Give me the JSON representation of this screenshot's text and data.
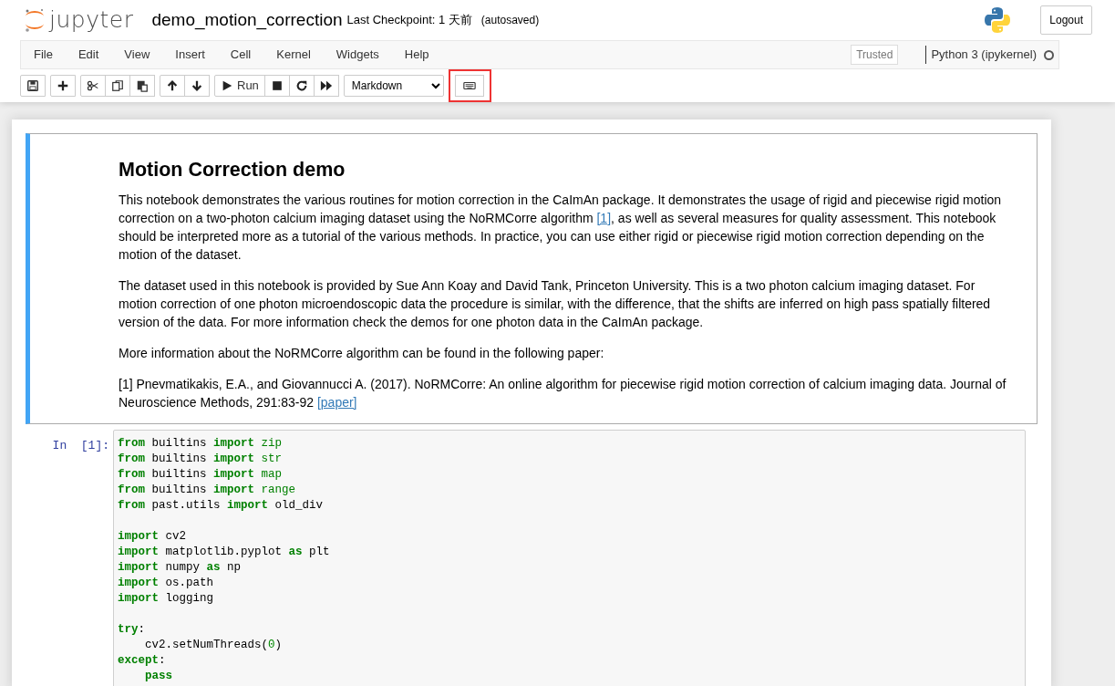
{
  "header": {
    "logo_text": "jupyter",
    "notebook_name": "demo_motion_correction",
    "checkpoint": "Last Checkpoint: 1 天前",
    "autosave": "(autosaved)",
    "logout": "Logout"
  },
  "menu": {
    "items": [
      "File",
      "Edit",
      "View",
      "Insert",
      "Cell",
      "Kernel",
      "Widgets",
      "Help"
    ],
    "trusted": "Trusted",
    "kernel": "Python 3 (ipykernel)",
    "kernel_busy": false
  },
  "toolbar": {
    "groups": [
      [
        {
          "kind": "save"
        }
      ],
      [
        {
          "kind": "plus"
        }
      ],
      [
        {
          "kind": "cut"
        },
        {
          "kind": "copy"
        },
        {
          "kind": "paste"
        }
      ],
      [
        {
          "kind": "up"
        },
        {
          "kind": "down"
        }
      ],
      [
        {
          "kind": "play",
          "label": "Run"
        },
        {
          "kind": "stop"
        },
        {
          "kind": "restart"
        },
        {
          "kind": "fastforward"
        }
      ]
    ],
    "cell_type": "Markdown",
    "keyboard_highlighted": true
  },
  "cells": [
    {
      "kind": "markdown",
      "selected": true,
      "heading": "Motion Correction demo",
      "paragraphs": [
        [
          {
            "text": "This notebook demonstrates the various routines for motion correction in the CaImAn package. It demonstrates the usage of rigid and piecewise rigid motion correction on a two-photon calcium imaging dataset using the NoRMCorre algorithm "
          },
          {
            "text": "[1]",
            "kind": "link"
          },
          {
            "text": ", as well as several measures for quality assessment. This notebook should be interpreted more as a tutorial of the various methods. In practice, you can use either rigid or piecewise rigid motion correction depending on the motion of the dataset."
          }
        ],
        [
          {
            "text": "The dataset used in this notebook is provided by Sue Ann Koay and David Tank, Princeton University. This is a two photon calcium imaging dataset. For motion correction of one photon microendoscopic data the procedure is similar, with the difference, that the shifts are inferred on high pass spatially filtered version of the data. For more information check the demos for one photon data in the CaImAn package."
          }
        ],
        [
          {
            "text": "More information about the NoRMCorre algorithm can be found in the following paper:"
          }
        ],
        [
          {
            "text": "[1] Pnevmatikakis, E.A., and Giovannucci A. (2017). NoRMCorre: An online algorithm for piecewise rigid motion correction of calcium imaging data. Journal of Neuroscience Methods, 291:83-92 "
          },
          {
            "text": "[paper]",
            "kind": "link"
          }
        ]
      ]
    },
    {
      "kind": "code",
      "selected": false,
      "prompt": "In  [1]:",
      "blocks": [
        [
          {
            "indented": false,
            "tokens": [
              {
                "text": "from",
                "kind": "keyword"
              },
              {
                "text": " builtins "
              },
              {
                "text": "import",
                "kind": "keyword"
              },
              {
                "text": " zip",
                "kind": "builtin"
              }
            ]
          },
          {
            "indented": false,
            "tokens": [
              {
                "text": "from",
                "kind": "keyword"
              },
              {
                "text": " builtins "
              },
              {
                "text": "import",
                "kind": "keyword"
              },
              {
                "text": " str",
                "kind": "builtin"
              }
            ]
          },
          {
            "indented": false,
            "tokens": [
              {
                "text": "from",
                "kind": "keyword"
              },
              {
                "text": " builtins "
              },
              {
                "text": "import",
                "kind": "keyword"
              },
              {
                "text": " map",
                "kind": "builtin"
              }
            ]
          },
          {
            "indented": false,
            "tokens": [
              {
                "text": "from",
                "kind": "keyword"
              },
              {
                "text": " builtins "
              },
              {
                "text": "import",
                "kind": "keyword"
              },
              {
                "text": " range",
                "kind": "builtin"
              }
            ]
          },
          {
            "indented": false,
            "tokens": [
              {
                "text": "from",
                "kind": "keyword"
              },
              {
                "text": " past.utils "
              },
              {
                "text": "import",
                "kind": "keyword"
              },
              {
                "text": " old_div"
              }
            ]
          }
        ],
        [
          {
            "indented": false,
            "tokens": [
              {
                "text": "import",
                "kind": "keyword"
              },
              {
                "text": " cv2"
              }
            ]
          },
          {
            "indented": false,
            "tokens": [
              {
                "text": "import",
                "kind": "keyword"
              },
              {
                "text": " matplotlib.pyplot "
              },
              {
                "text": "as",
                "kind": "keyword"
              },
              {
                "text": " plt"
              }
            ]
          },
          {
            "indented": false,
            "tokens": [
              {
                "text": "import",
                "kind": "keyword"
              },
              {
                "text": " numpy "
              },
              {
                "text": "as",
                "kind": "keyword"
              },
              {
                "text": " np"
              }
            ]
          },
          {
            "indented": false,
            "tokens": [
              {
                "text": "import",
                "kind": "keyword"
              },
              {
                "text": " os.path"
              }
            ]
          },
          {
            "indented": false,
            "tokens": [
              {
                "text": "import",
                "kind": "keyword"
              },
              {
                "text": " logging"
              }
            ]
          }
        ],
        [
          {
            "indented": false,
            "tokens": [
              {
                "text": "try",
                "kind": "keyword"
              },
              {
                "text": ":"
              }
            ]
          },
          {
            "indented": true,
            "tokens": [
              {
                "text": "cv2.setNumThreads("
              },
              {
                "text": "0",
                "kind": "number"
              },
              {
                "text": ")"
              }
            ]
          },
          {
            "indented": false,
            "tokens": [
              {
                "text": "except",
                "kind": "keyword"
              },
              {
                "text": ":"
              }
            ]
          },
          {
            "indented": true,
            "tokens": [
              {
                "text": "pass",
                "kind": "keyword"
              }
            ]
          }
        ]
      ]
    }
  ]
}
